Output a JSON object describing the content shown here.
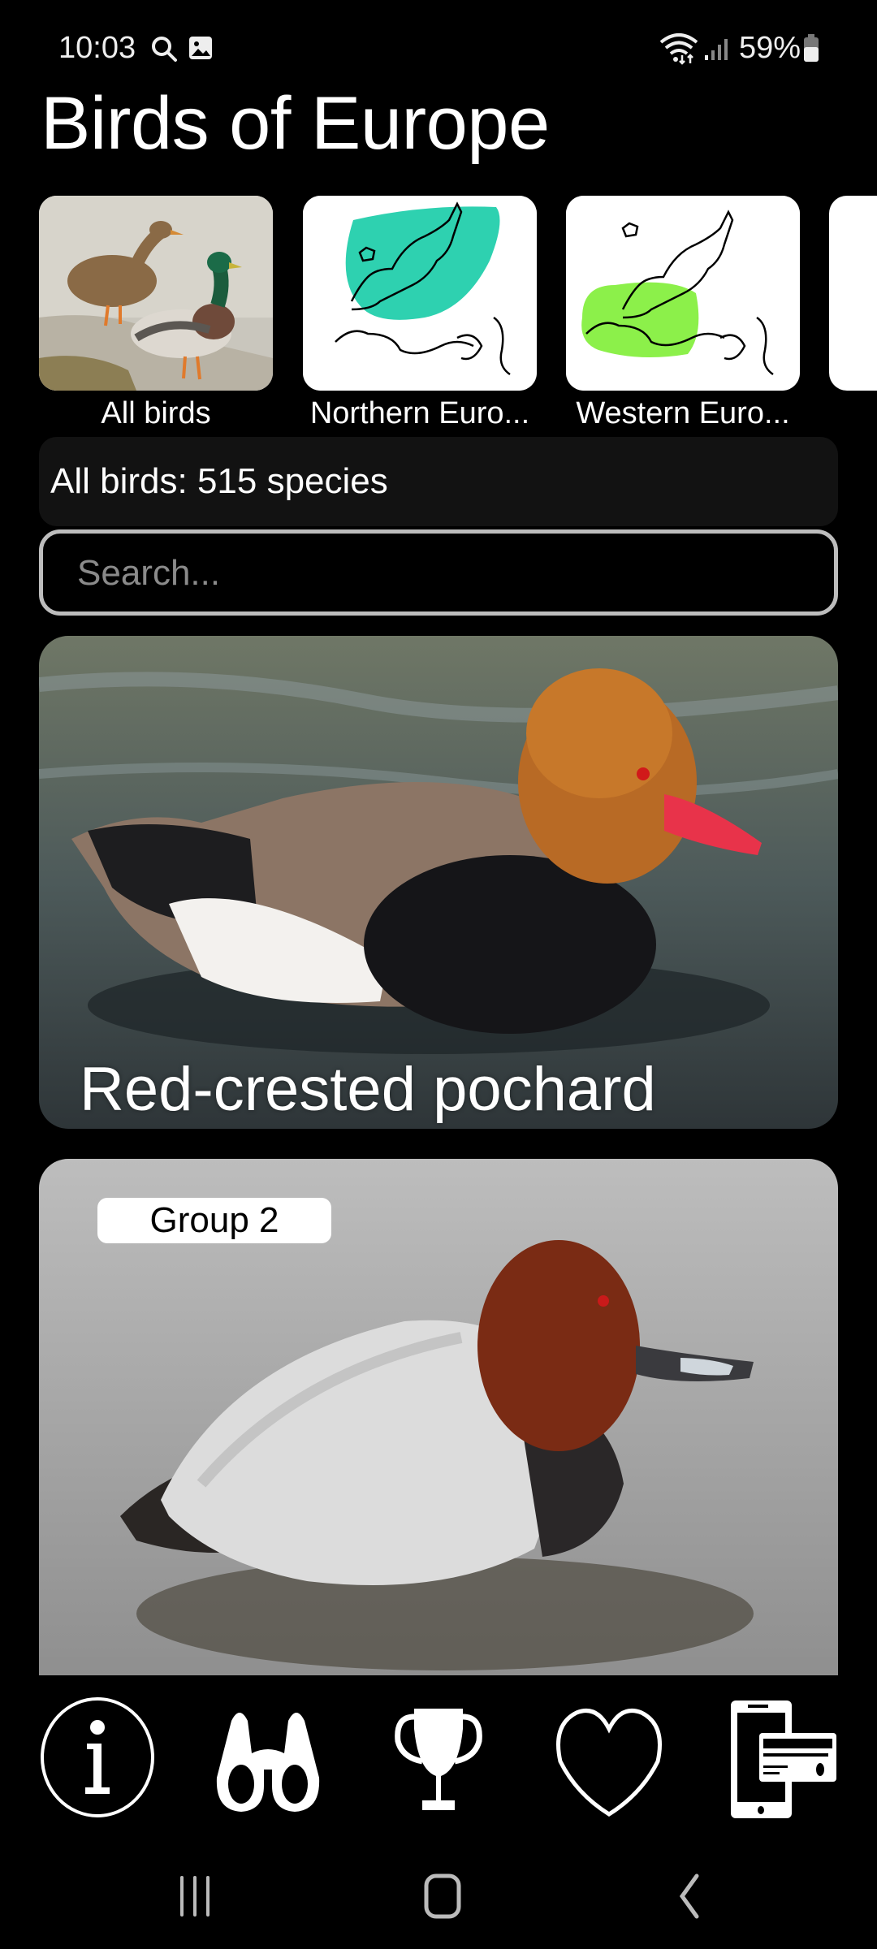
{
  "status_bar": {
    "time": "10:03",
    "battery_percent": "59%",
    "icons": [
      "search-icon",
      "image-icon",
      "wifi-icon",
      "signal-icon",
      "battery-icon"
    ]
  },
  "header": {
    "title": "Birds of Europe"
  },
  "regions": [
    {
      "label": "All birds",
      "image": "mallard-ducks-photo"
    },
    {
      "label": "Northern Euro...",
      "image": "northern-europe-map",
      "highlight_color": "#2ed1b0"
    },
    {
      "label": "Western Euro...",
      "image": "western-europe-map",
      "highlight_color": "#8cf04a"
    }
  ],
  "count_bar": {
    "text": "All birds: 515 species"
  },
  "search": {
    "placeholder": "Search...",
    "value": ""
  },
  "cards": [
    {
      "title": "Red-crested pochard",
      "image": "red-crested-pochard-photo"
    },
    {
      "badge": "Group 2",
      "image": "common-pochard-photo"
    }
  ],
  "bottom_nav": [
    {
      "name": "info",
      "icon": "info-icon"
    },
    {
      "name": "binoculars",
      "icon": "binoculars-icon"
    },
    {
      "name": "trophy",
      "icon": "trophy-icon"
    },
    {
      "name": "favorites",
      "icon": "heart-icon"
    },
    {
      "name": "purchase",
      "icon": "phone-card-icon"
    }
  ],
  "system_nav": [
    "recents",
    "home",
    "back"
  ]
}
